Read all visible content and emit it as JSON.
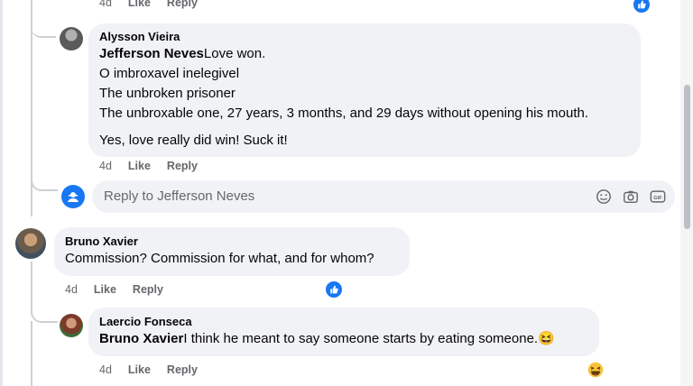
{
  "top_meta": {
    "time": "4d",
    "like": "Like",
    "reply": "Reply"
  },
  "comment_alysson": {
    "author": "Alysson Vieira",
    "mention": "Jefferson Neves",
    "lines": [
      "Love won.",
      "O imbroxavel inelegivel",
      "The unbroken prisoner",
      "The unbroxable one, 27 years, 3 months, and 29 days without opening his mouth."
    ],
    "last_line": "Yes, love really did win! Suck it!",
    "time": "4d",
    "like": "Like",
    "reply": "Reply"
  },
  "reply_composer": {
    "placeholder": "Reply to Jefferson Neves",
    "icons": [
      "emoji-icon",
      "camera-icon",
      "gif-icon"
    ]
  },
  "comment_bruno": {
    "author": "Bruno Xavier",
    "text": "Commission? Commission for what, and for whom?",
    "time": "4d",
    "like": "Like",
    "reply": "Reply",
    "reaction": "like-reaction-icon"
  },
  "comment_laercio": {
    "author": "Laercio Fonseca",
    "mention": "Bruno Xavier",
    "text": "I think he meant to say someone starts by eating someone.",
    "emoji": "😆",
    "time": "4d",
    "like": "Like",
    "reply": "Reply",
    "reaction": "haha-reaction-icon"
  },
  "colors": {
    "accent": "#1877f2",
    "bubble": "#f0f2f5",
    "meta": "#65676b"
  }
}
